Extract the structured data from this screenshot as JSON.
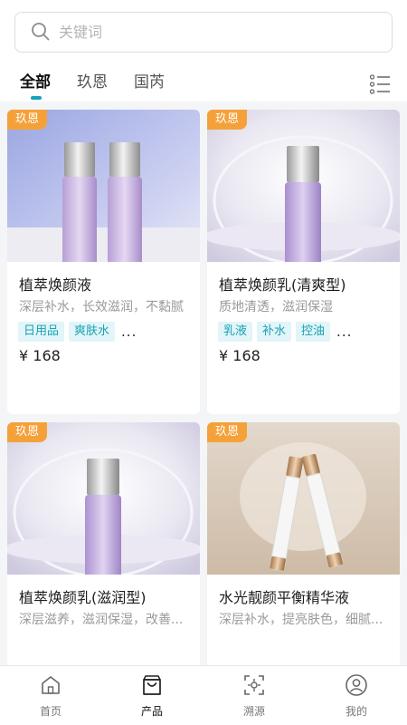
{
  "search": {
    "placeholder": "关键词",
    "value": ""
  },
  "tabs": [
    {
      "label": "全部",
      "active": true
    },
    {
      "label": "玖恩",
      "active": false
    },
    {
      "label": "国芮",
      "active": false
    }
  ],
  "products": [
    {
      "badge": "玖恩",
      "title": "植萃焕颜液",
      "desc": "深层补水，长效滋润，不黏腻",
      "tags": [
        "日用品",
        "爽肤水"
      ],
      "more": "...",
      "price": "¥ 168"
    },
    {
      "badge": "玖恩",
      "title": "植萃焕颜乳(清爽型)",
      "desc": "质地清透，滋润保湿",
      "tags": [
        "乳液",
        "补水",
        "控油"
      ],
      "more": "...",
      "price": "¥ 168"
    },
    {
      "badge": "玖恩",
      "title": "植萃焕颜乳(滋润型)",
      "desc": "深层滋养，滋润保湿，改善...",
      "tags": [],
      "more": "",
      "price": ""
    },
    {
      "badge": "玖恩",
      "title": "水光靓颜平衡精华液",
      "desc": "深层补水，提亮肤色，细腻...",
      "tags": [],
      "more": "",
      "price": ""
    }
  ],
  "bottom_nav": [
    {
      "label": "首页",
      "icon": "home-icon",
      "active": false
    },
    {
      "label": "产品",
      "icon": "shopping-bag-icon",
      "active": true
    },
    {
      "label": "溯源",
      "icon": "scan-trace-icon",
      "active": false
    },
    {
      "label": "我的",
      "icon": "user-icon",
      "active": false
    }
  ],
  "colors": {
    "accent": "#16a3b8",
    "badge": "#f5a13a",
    "tag_bg": "#e2f5f8"
  }
}
